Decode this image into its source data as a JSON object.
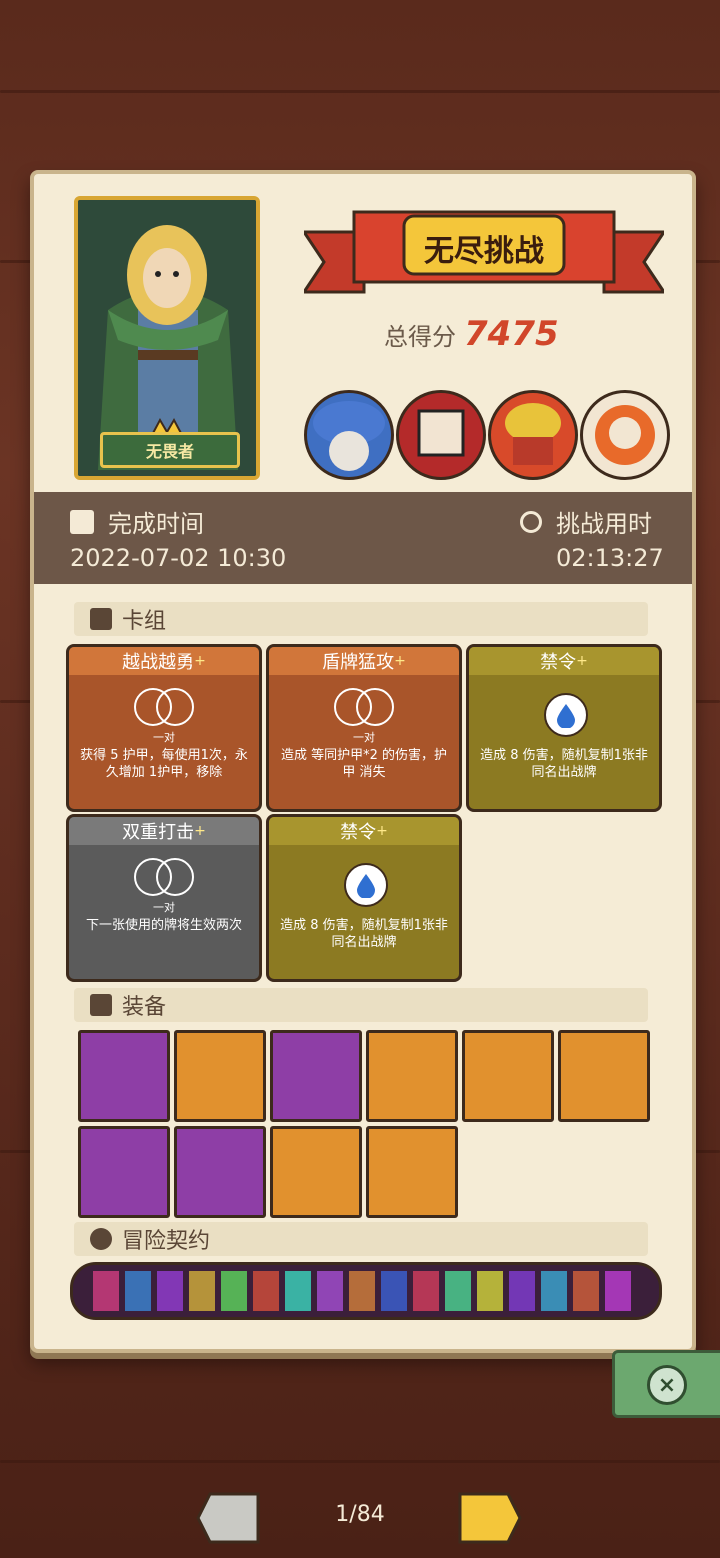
{
  "hero": {
    "name": "无畏者"
  },
  "header": {
    "banner_title": "无尽挑战",
    "score_label": "总得分",
    "score_value": "7475"
  },
  "time": {
    "complete_label": "完成时间",
    "complete_value": "2022-07-02 10:30",
    "duration_label": "挑战用时",
    "duration_value": "02:13:27"
  },
  "sections": {
    "deck": "卡组",
    "equipment": "装备",
    "contracts": "冒险契约"
  },
  "cards": [
    {
      "title": "越战越勇",
      "pair": "一对",
      "desc": "获得 5 护甲，每使用1次，永久增加 1护甲，移除"
    },
    {
      "title": "盾牌猛攻",
      "pair": "一对",
      "desc": "造成 等同护甲*2 的伤害，护甲 消失"
    },
    {
      "title": "禁令",
      "desc": "造成 8 伤害，随机复制1张非同名出战牌"
    },
    {
      "title": "双重打击",
      "pair": "一对",
      "desc": "下一张使用的牌将生效两次"
    },
    {
      "title": "禁令",
      "desc": "造成 8 伤害，随机复制1张非同名出战牌"
    }
  ],
  "plus_mark": "+",
  "pager": {
    "text": "1/84"
  },
  "icons": {
    "close": "close-icon",
    "calendar": "calendar-icon",
    "stopwatch": "stopwatch-icon"
  }
}
